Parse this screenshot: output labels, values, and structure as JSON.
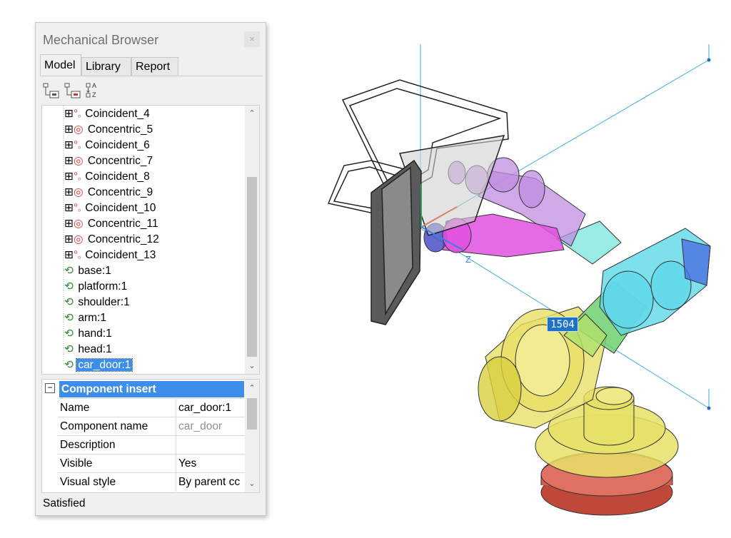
{
  "browser": {
    "title": "Mechanical Browser",
    "close_label": "×",
    "tabs": [
      {
        "label": "Model",
        "active": true
      },
      {
        "label": "Library",
        "active": false
      },
      {
        "label": "Report",
        "active": false
      }
    ],
    "toolbar": [
      "expand-tree-icon",
      "collapse-tree-icon",
      "sort-az-icon"
    ],
    "sort_label_a": "A",
    "sort_label_z": "Z",
    "tree": {
      "constraints": [
        {
          "label": "Coincident_4",
          "type": "coincident"
        },
        {
          "label": "Concentric_5",
          "type": "concentric"
        },
        {
          "label": "Coincident_6",
          "type": "coincident"
        },
        {
          "label": "Concentric_7",
          "type": "concentric"
        },
        {
          "label": "Coincident_8",
          "type": "coincident"
        },
        {
          "label": "Concentric_9",
          "type": "concentric"
        },
        {
          "label": "Coincident_10",
          "type": "coincident"
        },
        {
          "label": "Concentric_11",
          "type": "concentric"
        },
        {
          "label": "Concentric_12",
          "type": "concentric"
        },
        {
          "label": "Coincident_13",
          "type": "coincident"
        }
      ],
      "components": [
        {
          "label": "base:1"
        },
        {
          "label": "platform:1"
        },
        {
          "label": "shoulder:1"
        },
        {
          "label": "arm:1"
        },
        {
          "label": "hand:1"
        },
        {
          "label": "head:1"
        },
        {
          "label": "car_door:1",
          "selected": true
        }
      ]
    },
    "properties": {
      "header": "Component insert",
      "collapse_symbol": "−",
      "rows": [
        {
          "key": "Name",
          "value": "car_door:1",
          "dim": false
        },
        {
          "key": "Component name",
          "value": "car_door",
          "dim": true
        },
        {
          "key": "Description",
          "value": "",
          "dim": false
        },
        {
          "key": "Visible",
          "value": "Yes",
          "dim": false
        },
        {
          "key": "Visual style",
          "value": "By parent cc",
          "dim": false
        }
      ]
    },
    "status": "Satisfied"
  },
  "viewport": {
    "dimension_value": "1504",
    "axis_label": "Z",
    "colors": {
      "selection": "#3d8ee8",
      "axis_line": "#3aaed8",
      "base_red": "#d85c4c",
      "yellow": "#e8e066",
      "green": "#6fd06f",
      "cyan": "#5fd8e8",
      "blue": "#4a6fe0",
      "magenta": "#e050e0",
      "violet": "#c08ce0",
      "door_gray": "#8a8a8a"
    }
  }
}
